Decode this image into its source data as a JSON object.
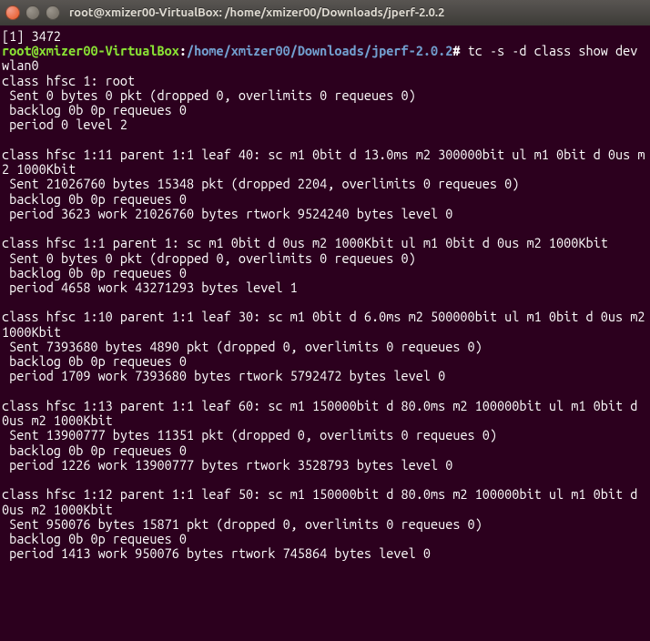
{
  "window": {
    "title": "root@xmizer00-VirtualBox: /home/xmizer00/Downloads/jperf-2.0.2"
  },
  "prompt": {
    "user_host": "root@xmizer00-VirtualBox",
    "sep1": ":",
    "path": "/home/xmizer00/Downloads/jperf-2.0.2",
    "sep2": "#"
  },
  "lines": {
    "l0": "[1] 3472",
    "cmd": " tc -s -d class show dev wlan0",
    "l2": "class hfsc 1: root",
    "l3": " Sent 0 bytes 0 pkt (dropped 0, overlimits 0 requeues 0)",
    "l4": " backlog 0b 0p requeues 0",
    "l5": " period 0 level 2",
    "blank": "",
    "l6": "class hfsc 1:11 parent 1:1 leaf 40: sc m1 0bit d 13.0ms m2 300000bit ul m1 0bit d 0us m2 1000Kbit",
    "l7": " Sent 21026760 bytes 15348 pkt (dropped 2204, overlimits 0 requeues 0)",
    "l8": " backlog 0b 0p requeues 0",
    "l9": " period 3623 work 21026760 bytes rtwork 9524240 bytes level 0",
    "l10": "class hfsc 1:1 parent 1: sc m1 0bit d 0us m2 1000Kbit ul m1 0bit d 0us m2 1000Kbit",
    "l11": " Sent 0 bytes 0 pkt (dropped 0, overlimits 0 requeues 0)",
    "l12": " backlog 0b 0p requeues 0",
    "l13": " period 4658 work 43271293 bytes level 1",
    "l14": "class hfsc 1:10 parent 1:1 leaf 30: sc m1 0bit d 6.0ms m2 500000bit ul m1 0bit d 0us m2 1000Kbit",
    "l15": " Sent 7393680 bytes 4890 pkt (dropped 0, overlimits 0 requeues 0)",
    "l16": " backlog 0b 0p requeues 0",
    "l17": " period 1709 work 7393680 bytes rtwork 5792472 bytes level 0",
    "l18": "class hfsc 1:13 parent 1:1 leaf 60: sc m1 150000bit d 80.0ms m2 100000bit ul m1 0bit d 0us m2 1000Kbit",
    "l19": " Sent 13900777 bytes 11351 pkt (dropped 0, overlimits 0 requeues 0)",
    "l20": " backlog 0b 0p requeues 0",
    "l21": " period 1226 work 13900777 bytes rtwork 3528793 bytes level 0",
    "l22": "class hfsc 1:12 parent 1:1 leaf 50: sc m1 150000bit d 80.0ms m2 100000bit ul m1 0bit d 0us m2 1000Kbit",
    "l23": " Sent 950076 bytes 15871 pkt (dropped 0, overlimits 0 requeues 0)",
    "l24": " backlog 0b 0p requeues 0",
    "l25": " period 1413 work 950076 bytes rtwork 745864 bytes level 0"
  }
}
